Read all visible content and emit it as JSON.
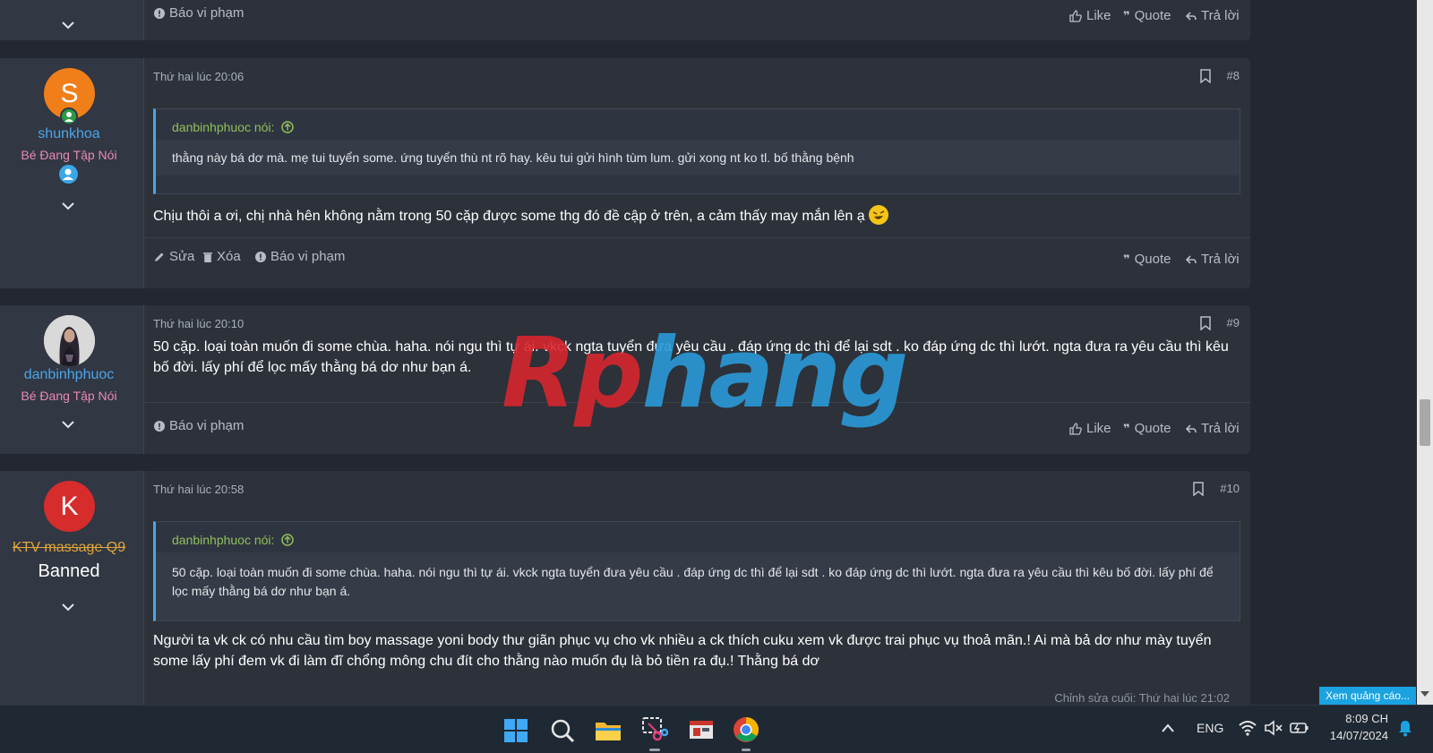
{
  "post_top": {
    "report_label": "Báo vi phạm",
    "like_label": "Like",
    "quote_label": "Quote",
    "reply_label": "Trả lời"
  },
  "posts": [
    {
      "avatar_letter": "S",
      "avatar_color": "#f07f1a",
      "username": "shunkhoa",
      "user_title": "Bé Đang Tập Nói",
      "date": "Thứ hai lúc 20:06",
      "number": "#8",
      "quote_author": "danbinhphuoc nói:",
      "quote_text": "thằng này bá dơ mà. mẹ tui tuyển some. ứng tuyển thù nt rõ hay. kêu tui gửi hình tùm lum. gửi xong nt ko tl. bố thằng bệnh",
      "text": "Chịu thôi a ơi, chị nhà hên không nằm trong 50 cặp được some thg đó đề cập ở trên, a cảm thấy may mắn lên ạ",
      "edit_label": "Sửa",
      "delete_label": "Xóa",
      "report_label": "Báo vi phạm",
      "quote_label": "Quote",
      "reply_label": "Trả lời"
    },
    {
      "username": "danbinhphuoc",
      "user_title": "Bé Đang Tập Nói",
      "date": "Thứ hai lúc 20:10",
      "number": "#9",
      "text": "50 cặp. loại toàn muốn đi some chùa. haha. nói ngu thì tự ái. vkck ngta tuyển đưa yêu cầu . đáp ứng dc thì để lại sdt . ko đáp ứng dc thì lướt. ngta đưa ra yêu cầu thì kêu bố đời. lấy phí để lọc mấy thằng bá dơ như bạn á.",
      "report_label": "Báo vi phạm",
      "like_label": "Like",
      "quote_label": "Quote",
      "reply_label": "Trả lời"
    },
    {
      "avatar_letter": "K",
      "avatar_color": "#d62c2c",
      "username": "KTV massage Q9",
      "user_title": "Banned",
      "date": "Thứ hai lúc 20:58",
      "number": "#10",
      "quote_author": "danbinhphuoc nói:",
      "quote_text": "50 cặp. loại toàn muốn đi some chùa. haha. nói ngu thì tự ái. vkck ngta tuyển đưa yêu cầu . đáp ứng dc thì để lại sdt . ko đáp ứng dc thì lướt. ngta đưa ra yêu cầu thì kêu bố đời. lấy phí để lọc mấy thằng bá dơ như bạn á.",
      "text": "Người ta vk ck có nhu cầu tìm boy massage yoni body thư giãn phục vụ cho vk nhiều a ck thích cuku xem vk được trai phục vụ thoả mãn.! Ai mà bả dơ như mày tuyển some lấy phí đem vk đi làm đĩ chổng mông chu đít cho thằng nào muốn đụ là bỏ tiền ra đụ.! Thằng bá dơ",
      "last_edit": "Chỉnh sửa cuối: Thứ hai lúc 21:02"
    }
  ],
  "watermark": {
    "part1": "Rp",
    "part2": "hang"
  },
  "ad_label": "Xem quảng cáo...",
  "taskbar": {
    "lang": "ENG",
    "time": "8:09 CH",
    "date": "14/07/2024"
  },
  "colors": {
    "accent": "#4aa6e8",
    "quote_author": "#8fbf5a",
    "user_title": "#e88ab2",
    "banned_name": "#e0a63a"
  }
}
